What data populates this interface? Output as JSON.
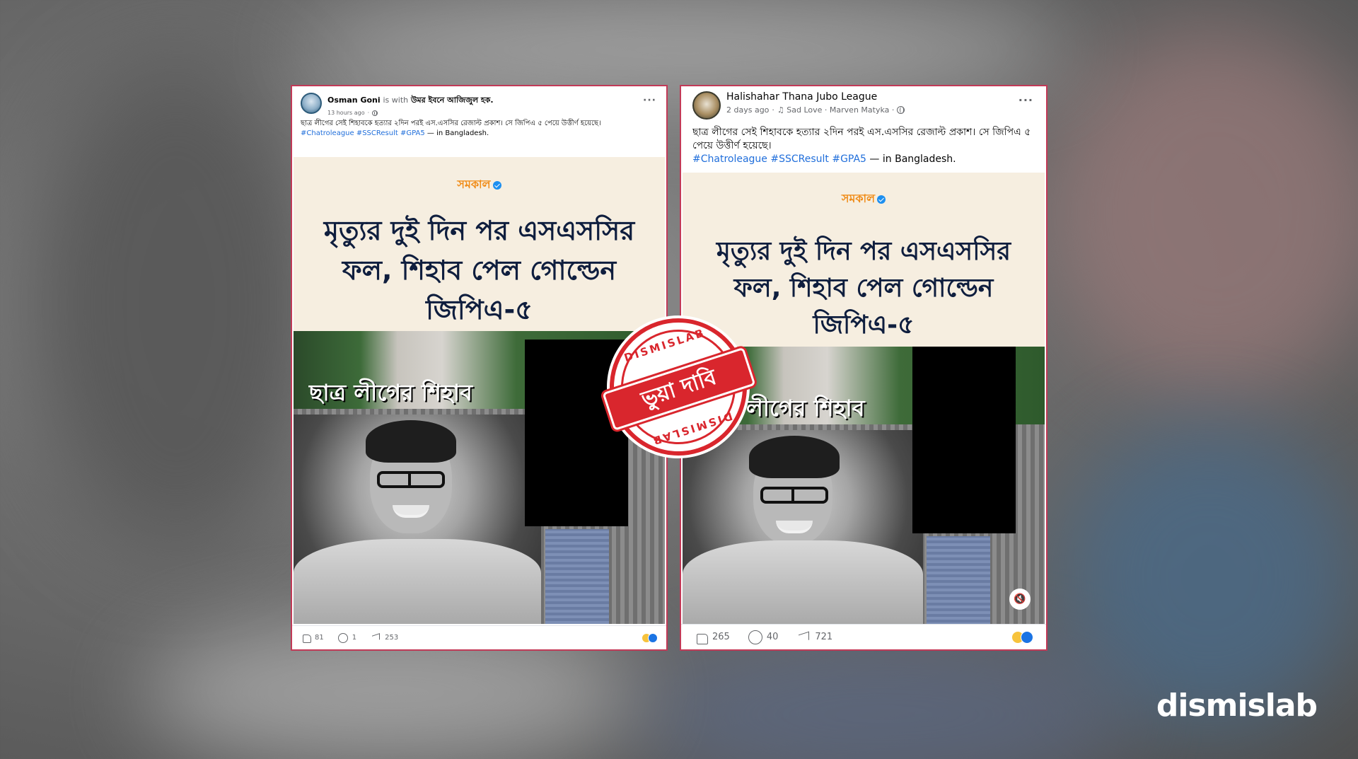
{
  "left_post": {
    "author": "Osman Goni",
    "with_text": "is with",
    "tagged": "উমর ইবনে আজিজুল হক.",
    "time": "13 hours ago",
    "caption": "ছাত্র লীগের সেই শিহাবকে হত্যার ২দিন পরই এস.এসসির রেজাল্ট প্রকাশ। সে জিপিএ ৫ পেয়ে উত্তীর্ণ হয়েছে।",
    "hashtags": "#Chatroleague #SSCResult #GPA5",
    "location": "— in Bangladesh.",
    "likes": "81",
    "comments": "1",
    "shares": "253"
  },
  "right_post": {
    "author": "Halishahar Thana Jubo League",
    "time": "2 days ago",
    "music": "♫ Sad Love · Marven Matyka ·",
    "caption": "ছাত্র লীগের সেই শিহাবকে হত্যার ২দিন পরই এস.এসসির রেজাল্ট প্রকাশ। সে জিপিএ ৫ পেয়ে উত্তীর্ণ হয়েছে।",
    "hashtags": "#Chatroleague #SSCResult #GPA5",
    "location": "— in Bangladesh.",
    "likes": "265",
    "comments": "40",
    "shares": "721"
  },
  "media": {
    "brand": "সমকাল",
    "headline": "মৃত্যুর দুই দিন পর এসএসসির ফল, শিহাব পেল গোল্ডেন জিপিএ-৫",
    "overlay_left": "ছাত্র লীগের শিহাব",
    "overlay_right": "লীগের শিহাব"
  },
  "stamp": {
    "ring_top": "DISMISLAB",
    "ring_bottom": "DISMISLAB",
    "label": "ভুয়া দাবি"
  },
  "watermark": "dismislab",
  "colors": {
    "border": "#c23a57",
    "stamp_red": "#d9262d",
    "hashtag_blue": "#216fdb",
    "brand_orange": "#f08a14"
  }
}
